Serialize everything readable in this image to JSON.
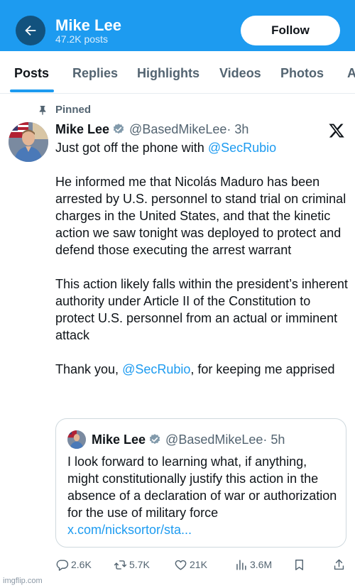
{
  "header": {
    "name": "Mike Lee",
    "posts": "47.2K posts",
    "follow_label": "Follow",
    "back_icon": "arrow-left-icon",
    "bg_color": "#1d9bf0"
  },
  "tabs": [
    {
      "label": "Posts",
      "active": true
    },
    {
      "label": "Replies",
      "active": false
    },
    {
      "label": "Highlights",
      "active": false
    },
    {
      "label": "Videos",
      "active": false
    },
    {
      "label": "Photos",
      "active": false
    },
    {
      "label": "A",
      "active": false
    }
  ],
  "pinned_label": "Pinned",
  "tweet": {
    "name": "Mike Lee",
    "handle": "@BasedMikeLee",
    "time": "· 3h",
    "paragraphs": {
      "p1_text": "Just got off the phone with ",
      "p1_mention": "@SecRubio",
      "p2": "He informed me that Nicolás Maduro has been arrested by U.S. personnel to stand trial on criminal charges in the United States, and that the kinetic action we saw tonight was deployed to protect and defend those executing the arrest warrant",
      "p3": "This action likely falls within the president’s inherent authority under Article II of the Constitution to protect U.S. personnel from an actual or imminent attack",
      "p4_before": "Thank you, ",
      "p4_mention": "@SecRubio",
      "p4_after": ", for keeping me apprised"
    }
  },
  "quote": {
    "name": "Mike Lee",
    "handle": "@BasedMikeLee",
    "time": "· 5h",
    "text": "I look forward to learning what, if anything, might constitutionally justify this action in the absence of a declaration of war or authorization for the use of military force",
    "link": "x.com/nicksortor/sta..."
  },
  "actions": {
    "replies": "2.6K",
    "reposts": "5.7K",
    "likes": "21K",
    "views": "3.6M"
  },
  "watermark": "imgflip.com",
  "colors": {
    "accent": "#1d9bf0",
    "secondary_text": "#536471",
    "primary_text": "#0f1419"
  }
}
